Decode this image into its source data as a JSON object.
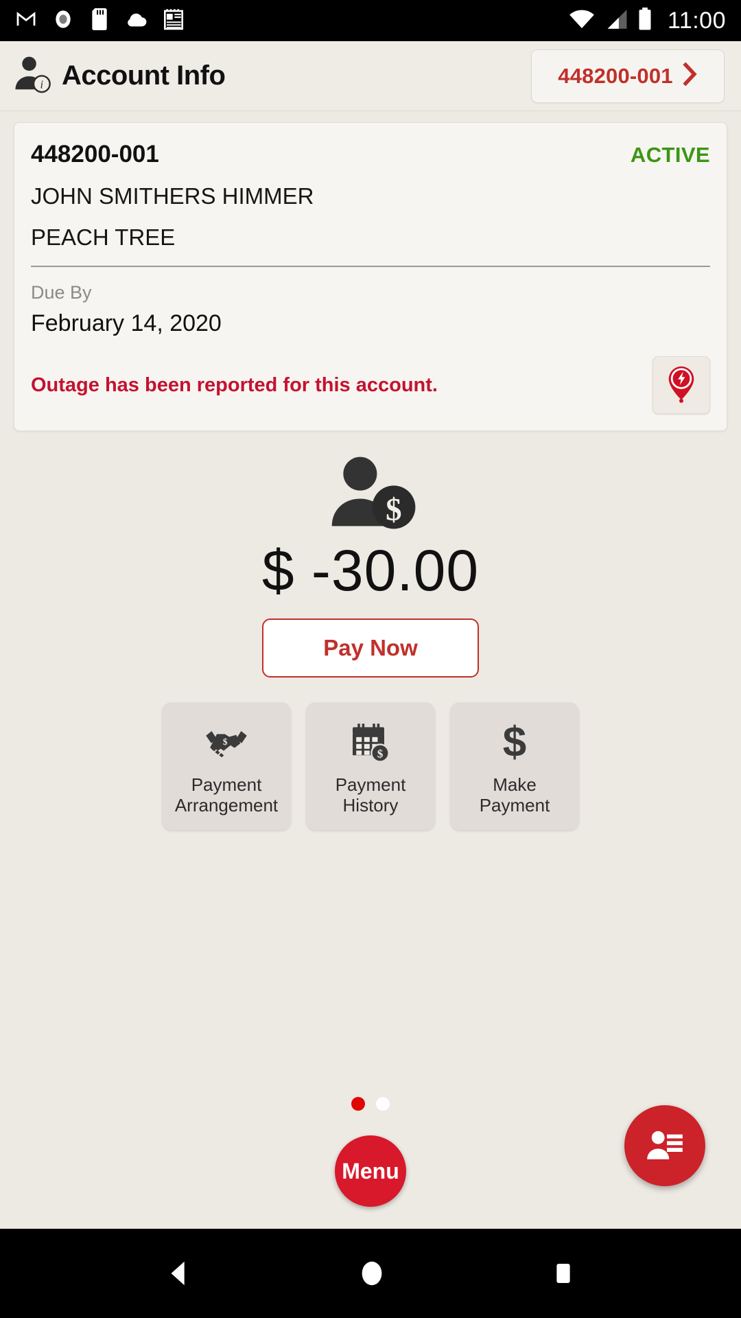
{
  "status_bar": {
    "time": "11:00",
    "left_icons": [
      "gmail-icon",
      "record-icon",
      "sd-card-icon",
      "cloud-icon",
      "notes-icon"
    ],
    "right_icons": [
      "wifi-icon",
      "cellular-signal-icon",
      "battery-icon"
    ]
  },
  "header": {
    "title": "Account Info",
    "icon": "account-info-icon",
    "account_selector": {
      "label": "448200-001",
      "chevron": "chevron-right-icon"
    }
  },
  "account_card": {
    "account_number": "448200-001",
    "status": "ACTIVE",
    "status_color": "#3a9613",
    "customer_name": "JOHN SMITHERS HIMMER",
    "service_address": "PEACH TREE",
    "due_by_label": "Due By",
    "due_date": "February 14, 2020",
    "outage_message": "Outage has been reported for this account.",
    "outage_color": "#c41230",
    "outage_icon": "outage-pin-icon"
  },
  "balance": {
    "icon": "person-dollar-icon",
    "amount": "$ -30.00",
    "pay_now_label": "Pay Now",
    "accent_color": "#c0302b"
  },
  "tiles": [
    {
      "label_line1": "Payment",
      "label_line2": "Arrangement",
      "icon": "handshake-dollar-icon"
    },
    {
      "label_line1": "Payment",
      "label_line2": "History",
      "icon": "calendar-dollar-icon"
    },
    {
      "label_line1": "Make",
      "label_line2": "Payment",
      "icon": "dollar-sign-icon"
    }
  ],
  "pager": {
    "total": 2,
    "active_index": 0,
    "active_color": "#e10600",
    "inactive_color": "#fdfdfd"
  },
  "menu_fab": {
    "label": "Menu",
    "color": "#d8182b"
  },
  "contact_fab": {
    "icon": "contact-card-icon",
    "color": "#cc2229"
  },
  "nav_bar": {
    "back": "back-triangle-icon",
    "home": "home-circle-icon",
    "recents": "recents-square-icon"
  }
}
